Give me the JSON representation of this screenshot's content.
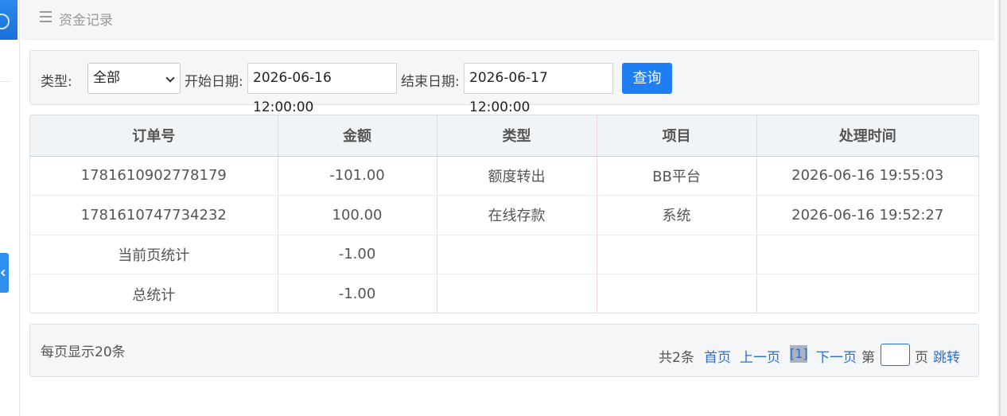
{
  "header": {
    "title": "资金记录"
  },
  "filter": {
    "type_label": "类型:",
    "type_value": "全部",
    "start_label": "开始日期:",
    "start_value": "2026-06-16 12:00:00",
    "end_label": "结束日期:",
    "end_value": "2026-06-17 12:00:00",
    "query_label": "查询"
  },
  "table": {
    "headers": [
      "订单号",
      "金额",
      "类型",
      "项目",
      "处理时间"
    ],
    "rows": [
      [
        "1781610902778179",
        "-101.00",
        "额度转出",
        "BB平台",
        "2026-06-16 19:55:03"
      ],
      [
        "1781610747734232",
        "100.00",
        "在线存款",
        "系统",
        "2026-06-16 19:52:27"
      ],
      [
        "当前页统计",
        "-1.00",
        "",
        "",
        ""
      ],
      [
        "总统计",
        "-1.00",
        "",
        "",
        ""
      ]
    ]
  },
  "pagination": {
    "per_page": "每页显示20条",
    "total": "共2条",
    "first": "首页",
    "prev": "上一页",
    "current": "[1]",
    "next": "下一页",
    "goto_prefix": "第",
    "goto_suffix": "页",
    "jump": "跳转"
  },
  "colors": {
    "primary": "#1f7ef2",
    "link": "#2d6fc8"
  }
}
